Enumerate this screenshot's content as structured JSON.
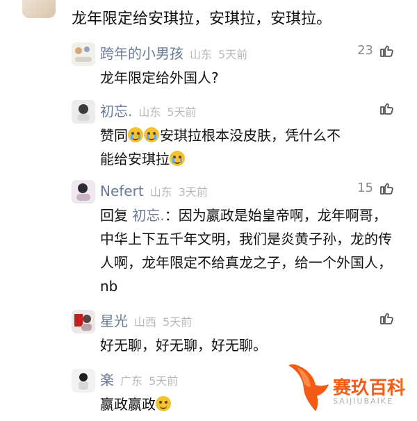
{
  "top_comment": {
    "text": "龙年限定给安琪拉，安琪拉，安琪拉。"
  },
  "replies": [
    {
      "name": "跨年的小男孩",
      "location": "山东",
      "time": "5天前",
      "likes": "23",
      "content_parts": {
        "text": "龙年限定给外国人?"
      }
    },
    {
      "name": "初忘.",
      "location": "山东",
      "time": "5天前",
      "likes": "",
      "content_parts": {
        "prefix": "赞同",
        "text1": "安琪拉根本没皮肤，凭什么不",
        "text2": "能给安琪拉"
      }
    },
    {
      "name": "Nefert",
      "location": "山东",
      "time": "3天前",
      "likes": "15",
      "content_parts": {
        "reply_label": "回复",
        "reply_target": "初忘.",
        "text": "：因为嬴政是始皇帝啊，龙年啊哥，中华上下五千年文明，我们是炎黄子孙，龙的传人啊，龙年限定不给真龙之子，给一个外国人，nb"
      }
    },
    {
      "name": "星光",
      "location": "山西",
      "time": "5天前",
      "likes": "",
      "content_parts": {
        "text": "好无聊，好无聊，好无聊。"
      }
    },
    {
      "name": "楽",
      "location": "广东",
      "time": "5天前",
      "likes": "",
      "content_parts": {
        "text": "嬴政嬴政"
      }
    }
  ],
  "icons": {
    "like": "thumbs-up-icon",
    "emoji_cry": "crying-face-icon",
    "emoji_grin": "grinning-face-icon"
  },
  "watermark": {
    "title": "赛玖百科",
    "subtitle": "SAIJIUBAIKE"
  },
  "colors": {
    "name": "#687a96",
    "meta": "#b8b8b8",
    "text": "#111111",
    "watermark": "#f45d16"
  }
}
